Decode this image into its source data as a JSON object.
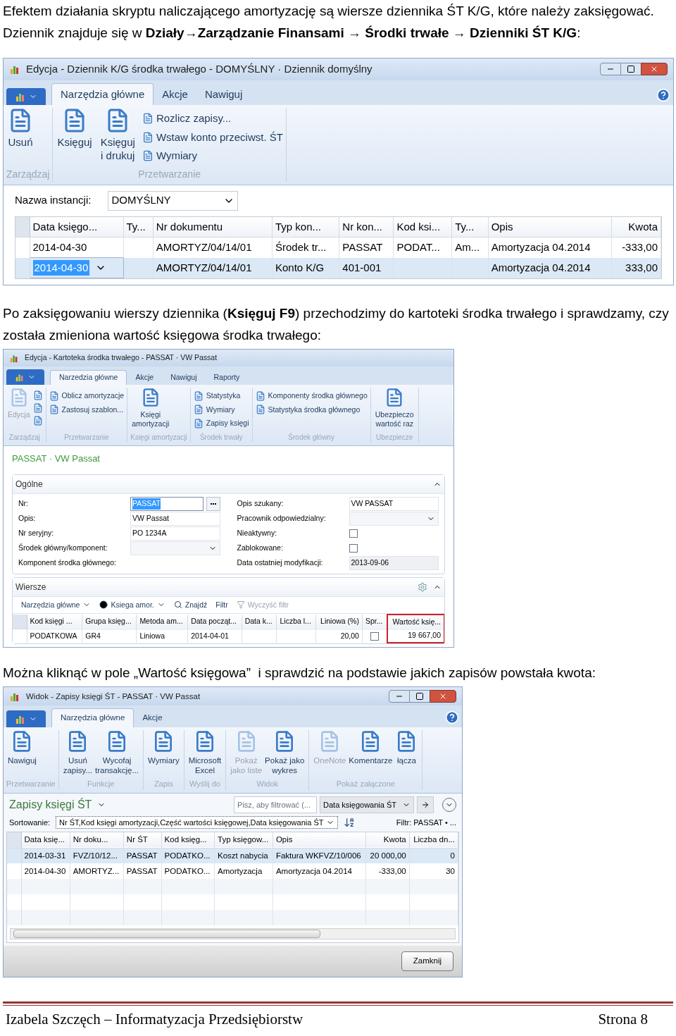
{
  "paragraph_1": [
    "Efektem działania skryptu naliczającego amortyzację są wiersze dziennika ŚT K/G, które należy zaksięgować.",
    "Dziennik znajduje się w **Działy→Zarządzanie Finansami → Środki trwałe → Dzienniki ŚT K/G**:"
  ],
  "journal_window": {
    "title": "Edycja - Dziennik K/G środka trwałego - DOMYŚLNY · Dziennik domyślny",
    "controls": true,
    "help": true,
    "tabs": [
      {
        "label": "Narzędzia główne",
        "selected": true
      },
      {
        "label": "Akcje",
        "selected": false
      },
      {
        "label": "Nawiguj",
        "selected": false
      }
    ],
    "ribbon": [
      {
        "label": "Zarządzaj",
        "items": [
          {
            "kind": "large",
            "label": "Usuń",
            "disabled": false
          }
        ]
      },
      {
        "label": "Przetwarzanie",
        "items": [
          {
            "kind": "large",
            "label": "Księguj",
            "disabled": false
          },
          {
            "kind": "large",
            "label": "Księguj\ni drukuj",
            "disabled": false
          },
          {
            "kind": "small",
            "label": "Rozlicz zapisy...",
            "disabled": false
          },
          {
            "kind": "small",
            "label": "Wstaw konto przeciwst. ŚT",
            "disabled": false
          },
          {
            "kind": "small",
            "label": "Wymiary",
            "disabled": false
          }
        ]
      }
    ],
    "instance": {
      "label": "Nazwa instancji:",
      "value": "DOMYŚLNY"
    },
    "table": {
      "columns": [
        {
          "label": "Data księgo...",
          "numeric": false
        },
        {
          "label": "Ty...",
          "numeric": false
        },
        {
          "label": "Nr dokumentu",
          "numeric": false
        },
        {
          "label": "Typ kon...",
          "numeric": false
        },
        {
          "label": "Nr kon...",
          "numeric": false
        },
        {
          "label": "Kod ksi...",
          "numeric": false
        },
        {
          "label": "Ty...",
          "numeric": false
        },
        {
          "label": "Opis",
          "numeric": false
        },
        {
          "label": "Kwota",
          "numeric": true
        }
      ],
      "rows": [
        {
          "selected": false,
          "cells": [
            "2014-04-30",
            null,
            "AMORTYZ/04/14/01",
            "Środek tr...",
            "PASSAT",
            "PODAT...",
            "Am...",
            "Amortyzacja 04.2014",
            "-333,00"
          ]
        },
        {
          "selected": true,
          "cells": [
            "2014-04-30",
            null,
            "AMORTYZ/04/14/01",
            "Konto K/G",
            "401-001",
            null,
            null,
            "Amortyzacja 04.2014",
            "333,00"
          ]
        }
      ]
    }
  },
  "paragraph_2": "Po zaksięgowaniu wierszy dziennika (**Księguj F9**) przechodzimy do kartoteki środka trwałego i sprawdzamy, czy została zmieniona wartość księgowa środka trwałego:",
  "card_window": {
    "title": "Edycja - Kartoteka środka trwałego - PASSAT · VW Passat",
    "controls": false,
    "help": false,
    "tabs": [
      {
        "label": "Narzedzia główne",
        "selected": true
      },
      {
        "label": "Akcje",
        "selected": false
      },
      {
        "label": "Nawiguj",
        "selected": false
      },
      {
        "label": "Raporty",
        "selected": false
      }
    ],
    "ribbon": [
      {
        "label": "Zarządzaj",
        "items": [
          {
            "kind": "large",
            "label": "Edycja",
            "disabled": true
          },
          {
            "kind": "icon",
            "disabled": false
          },
          {
            "kind": "icon",
            "disabled": false
          },
          {
            "kind": "icon",
            "disabled": false
          }
        ]
      },
      {
        "label": "Przetwarzanie",
        "items": [
          {
            "kind": "small",
            "label": "Oblicz amortyzacje",
            "disabled": false
          },
          {
            "kind": "small",
            "label": "Zastosuj szablon...",
            "disabled": false
          }
        ]
      },
      {
        "label": "Księgi amortyzacji",
        "items": [
          {
            "kind": "large",
            "label": "Księgi\namortyzacji",
            "disabled": false
          }
        ]
      },
      {
        "label": "Środek trwały",
        "items": [
          {
            "kind": "small",
            "label": "Statystyka",
            "disabled": false
          },
          {
            "kind": "small",
            "label": "Wymiary",
            "disabled": false
          },
          {
            "kind": "small",
            "label": "Zapisy księgi",
            "disabled": false
          }
        ]
      },
      {
        "label": "Środek główny",
        "items": [
          {
            "kind": "small",
            "label": "Komponenty środka głównego",
            "disabled": false
          },
          {
            "kind": "small",
            "label": "Statystyka środka głównego",
            "disabled": false
          }
        ]
      },
      {
        "label": "Ubezpiecze",
        "items": [
          {
            "kind": "large",
            "label": "Ubezpieczo\nwartość raz",
            "disabled": false
          }
        ]
      }
    ],
    "record_title": "PASSAT · VW Passat",
    "general": {
      "title": "Ogólne",
      "expanded": true,
      "left": [
        {
          "kind": "lookup",
          "label": "Nr:",
          "value": "PASSAT",
          "focused": true
        },
        {
          "kind": "text",
          "label": "Opis:",
          "value": "VW Passat",
          "focused": false
        },
        {
          "kind": "text",
          "label": "Nr seryjny:",
          "value": "PO 1234A",
          "focused": false
        },
        {
          "kind": "dropdown",
          "label": "Środek główny/komponent:"
        },
        {
          "kind": "label",
          "label": "Komponent środka głównego:"
        }
      ],
      "right": [
        {
          "kind": "text",
          "label": "Opis szukany:",
          "value": "VW PASSAT",
          "focused": false
        },
        {
          "kind": "dropdown",
          "label": "Pracownik odpowiedzialny:"
        },
        {
          "kind": "checkbox",
          "label": "Nieaktywny:",
          "checked": false
        },
        {
          "kind": "checkbox",
          "label": "Zablokowane:",
          "checked": false
        },
        {
          "kind": "readonly",
          "label": "Data ostatniej modyfikacji:",
          "value": "2013-09-06"
        }
      ]
    },
    "lines": {
      "title": "Wiersze",
      "expanded": true,
      "toolbar": [
        {
          "kind": "menu",
          "label": "Narzędzia główne",
          "disabled": false
        },
        {
          "kind": "menu",
          "label": "Ksiega amor.",
          "disabled": false
        },
        {
          "kind": "button",
          "label": "Znajdź",
          "disabled": false
        },
        {
          "kind": "button",
          "label": "Filtr",
          "disabled": false
        },
        {
          "kind": "button",
          "label": "Wyczyść filtr",
          "disabled": true
        }
      ],
      "table": {
        "columns": [
          {
            "label": "Kod księgi ...",
            "numeric": false,
            "highlighted": false
          },
          {
            "label": "Grupa księg...",
            "numeric": false,
            "highlighted": false
          },
          {
            "label": "Metoda am...",
            "numeric": false,
            "highlighted": false
          },
          {
            "label": "Data począt...",
            "numeric": false,
            "highlighted": false
          },
          {
            "label": "Data k...",
            "numeric": false,
            "highlighted": false
          },
          {
            "label": "Liczba l...",
            "numeric": false,
            "highlighted": false
          },
          {
            "label": "Liniowa (%)",
            "numeric": true,
            "highlighted": false
          },
          {
            "label": "Spr...",
            "numeric": false,
            "highlighted": false
          },
          {
            "label": "Wartość księ...",
            "numeric": true,
            "highlighted": true
          }
        ],
        "rows": [
          {
            "selected": false,
            "cells": [
              "PODATKOWA",
              "GR4",
              "Liniowa",
              "2014-04-01",
              null,
              null,
              "20,00",
              {
                "checked": false
              },
              "19 667,00"
            ]
          }
        ]
      }
    }
  },
  "paragraph_3": "Można kliknąć w pole „Wartość księgowa”  i sprawdzić na podstawie jakich zapisów powstała kwota:",
  "entries_window": {
    "title": "Widok - Zapisy księgi ŚT - PASSAT · VW Passat",
    "controls": true,
    "help": true,
    "tabs": [
      {
        "label": "Narzędzia główne",
        "selected": true
      },
      {
        "label": "Akcje",
        "selected": false
      }
    ],
    "ribbon": [
      {
        "label": "Przetwarzanie",
        "items": [
          {
            "kind": "large",
            "label": "Nawiguj",
            "disabled": false
          }
        ]
      },
      {
        "label": "Funkcje",
        "items": [
          {
            "kind": "large",
            "label": "Usuń\nzapisy...",
            "disabled": false
          },
          {
            "kind": "large",
            "label": "Wycofaj\ntransakcję...",
            "disabled": false
          }
        ]
      },
      {
        "label": "Zapis",
        "items": [
          {
            "kind": "large",
            "label": "Wymiary",
            "disabled": false
          }
        ]
      },
      {
        "label": "Wyślij do",
        "items": [
          {
            "kind": "large",
            "label": "Microsoft\nExcel",
            "disabled": false
          }
        ]
      },
      {
        "label": "Widok",
        "items": [
          {
            "kind": "large",
            "label": "Pokaż\njako liste",
            "disabled": true
          },
          {
            "kind": "large",
            "label": "Pokaż jako\nwykres",
            "disabled": false
          }
        ]
      },
      {
        "label": "Pokaż załączone",
        "items": [
          {
            "kind": "large",
            "label": "OneNote",
            "disabled": true
          },
          {
            "kind": "large",
            "label": "Komentarze",
            "disabled": false
          },
          {
            "kind": "large",
            "label": "łącza",
            "disabled": false
          }
        ]
      }
    ],
    "list_title": "Zapisy księgi ŚT",
    "filter": {
      "placeholder": "Pisz, aby filtrować (...",
      "field": "Data księgowania ŚT"
    },
    "sorting": {
      "label": "Sortowanie:",
      "value": "Nr ŚT,Kod księgi amortyzacji,Część wartości księgowej,Data księgowania ŚT"
    },
    "filter_summary": "Filtr: PASSAT • ...",
    "table": {
      "columns": [
        {
          "label": "Data księ...",
          "numeric": false
        },
        {
          "label": "Nr doku...",
          "numeric": false
        },
        {
          "label": "Nr ŚT",
          "numeric": false
        },
        {
          "label": "Kod księg...",
          "numeric": false
        },
        {
          "label": "Typ księgow...",
          "numeric": false
        },
        {
          "label": "Opis",
          "numeric": false
        },
        {
          "label": "Kwota",
          "numeric": true
        },
        {
          "label": "Liczba dn...",
          "numeric": true
        }
      ],
      "rows": [
        {
          "selected": true,
          "cells": [
            "2014-03-31",
            "FVZ/10/12...",
            "PASSAT",
            "PODATKO...",
            "Koszt nabycia",
            "Faktura WKFVZ/10/006",
            "20 000,00",
            "0"
          ]
        },
        {
          "selected": false,
          "cells": [
            "2014-04-30",
            "AMORTYZ...",
            "PASSAT",
            "PODATKO...",
            "Amortyzacja",
            "Amortyzacja 04.2014",
            "-333,00",
            "30"
          ]
        }
      ]
    },
    "close_button": "Zamknij"
  },
  "footer": {
    "left": "Izabela Szczęch – Informatyzacja Przedsiębiorstw",
    "right": "Strona 8"
  }
}
